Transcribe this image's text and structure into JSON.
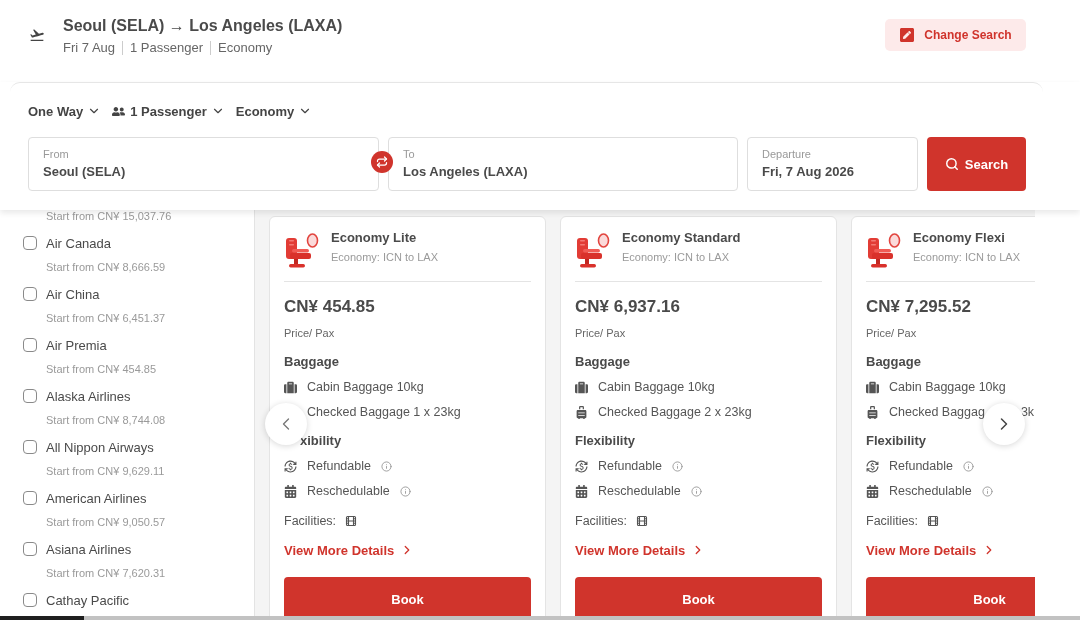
{
  "header": {
    "title": "Seoul (SELA) → Los Angeles (LAXA)",
    "details": [
      "Fri 7 Aug",
      "1 Passenger",
      "Economy"
    ],
    "change_button": "Change Search"
  },
  "search": {
    "trip_type": "One Way",
    "passengers": "1 Passenger",
    "cabin_class": "Economy",
    "fields": [
      {
        "label": "From",
        "value": "Seoul (SELA)"
      },
      {
        "label": "To",
        "value": "Los Angeles (LAXA)"
      },
      {
        "label": "Departure",
        "value": "Fri, 7 Aug 2026"
      }
    ],
    "search_button": "Search"
  },
  "airline_filter": [
    {
      "price": "Start from CN¥ 15,037.76"
    },
    {
      "name": "Air Canada",
      "price": "Start from CN¥ 8,666.59",
      "checked": false
    },
    {
      "name": "Air China",
      "price": "Start from CN¥ 6,451.37",
      "checked": false
    },
    {
      "name": "Air Premia",
      "price": "Start from CN¥ 454.85",
      "checked": false
    },
    {
      "name": "Alaska Airlines",
      "price": "Start from CN¥ 8,744.08",
      "checked": false
    },
    {
      "name": "All Nippon Airways",
      "price": "Start from CN¥ 9,629.11",
      "checked": false
    },
    {
      "name": "American Airlines",
      "price": "Start from CN¥ 9,050.57",
      "checked": false
    },
    {
      "name": "Asiana Airlines",
      "price": "Start from CN¥ 7,620.31",
      "checked": false
    },
    {
      "name": "Cathay Pacific",
      "checked": false
    }
  ],
  "fares": [
    {
      "title": "Economy Lite",
      "route": "Economy: ICN to LAX",
      "price": "CN¥ 454.85",
      "price_note": "Price/ Pax",
      "baggage_heading": "Baggage",
      "baggage": [
        {
          "kind": "cabin",
          "text": "Cabin Baggage 10kg"
        },
        {
          "text": "Checked Baggage 1 x 23kg"
        }
      ],
      "flexibility_heading": "xibility",
      "flexibility": [
        {
          "kind": "refund",
          "text": "Refundable"
        },
        {
          "kind": "reschedule",
          "text": "Reschedulable"
        }
      ],
      "facilities_label": "Facilities:",
      "details_link": "View More Details",
      "book_button": "Book"
    },
    {
      "title": "Economy Standard",
      "route": "Economy: ICN to LAX",
      "price": "CN¥ 6,937.16",
      "price_note": "Price/ Pax",
      "baggage_heading": "Baggage",
      "baggage": [
        {
          "kind": "cabin",
          "text": "Cabin Baggage 10kg"
        },
        {
          "kind": "checked",
          "text": "Checked Baggage 2 x 23kg"
        }
      ],
      "flexibility_heading": "Flexibility",
      "flexibility": [
        {
          "kind": "refund",
          "text": "Refundable"
        },
        {
          "kind": "reschedule",
          "text": "Reschedulable"
        }
      ],
      "facilities_label": "Facilities:",
      "details_link": "View More Details",
      "book_button": "Book"
    },
    {
      "title": "Economy Flexi",
      "route": "Economy: ICN to LAX",
      "price": "CN¥ 7,295.52",
      "price_note": "Price/ Pax",
      "baggage_heading": "Baggage",
      "baggage": [
        {
          "kind": "cabin",
          "text": "Cabin Baggage 10kg"
        },
        {
          "kind": "checked",
          "text": "Checked Baggag",
          "text_end": "3k"
        }
      ],
      "flexibility_heading": "Flexibility",
      "flexibility": [
        {
          "kind": "refund",
          "text": "Refundable"
        },
        {
          "kind": "reschedule",
          "text": "Reschedulable"
        }
      ],
      "facilities_label": "Facilities:",
      "details_link": "View More Details",
      "book_button": "Book"
    }
  ]
}
